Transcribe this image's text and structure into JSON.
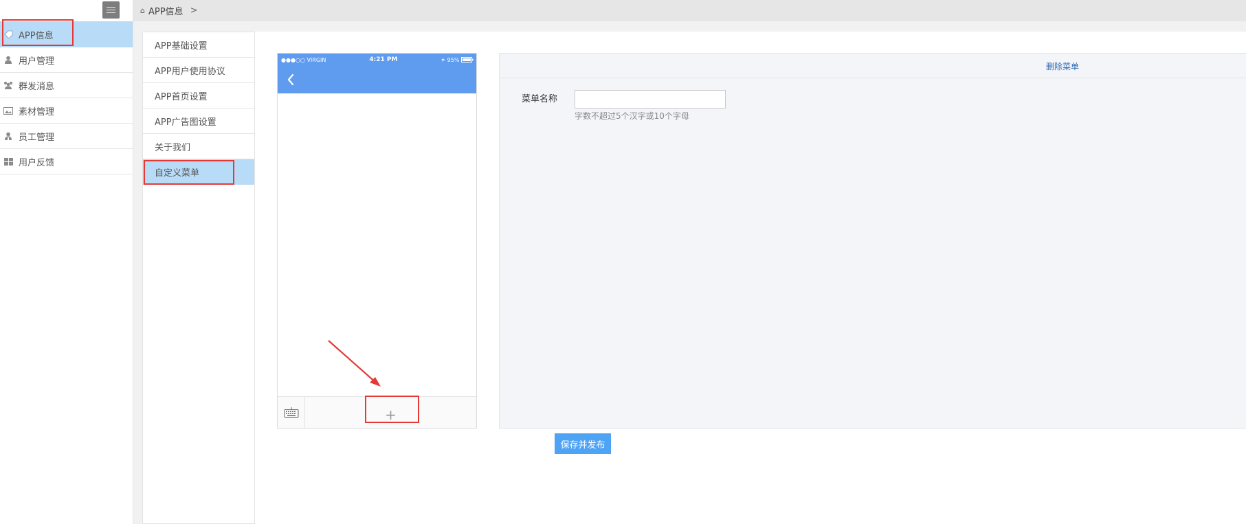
{
  "sidebar": {
    "items": [
      {
        "label": "APP信息",
        "icon": "tag-icon",
        "active": true
      },
      {
        "label": "用户管理",
        "icon": "user-icon",
        "active": false
      },
      {
        "label": "群发消息",
        "icon": "users-icon",
        "active": false
      },
      {
        "label": "素材管理",
        "icon": "image-icon",
        "active": false
      },
      {
        "label": "员工管理",
        "icon": "staff-icon",
        "active": false
      },
      {
        "label": "用户反馈",
        "icon": "grid-icon",
        "active": false
      }
    ]
  },
  "breadcrumb": {
    "current": "APP信息",
    "separator": ">"
  },
  "submenu": {
    "items": [
      {
        "label": "APP基础设置"
      },
      {
        "label": "APP用户使用协议"
      },
      {
        "label": "APP首页设置"
      },
      {
        "label": "APP广告图设置"
      },
      {
        "label": "关于我们"
      },
      {
        "label": "自定义菜单",
        "active": true
      }
    ]
  },
  "phone": {
    "carrier": "●●●○○ VIRGIN",
    "time": "4:21 PM",
    "battery": "95%",
    "add_label": "+"
  },
  "edit": {
    "delete_label": "删除菜单",
    "name_label": "菜单名称",
    "name_value": "",
    "name_hint": "字数不超过5个汉字或10个字母"
  },
  "actions": {
    "save_label": "保存并发布"
  },
  "colors": {
    "accent": "#5f9cef",
    "active_bg": "#b8dbf7",
    "button": "#4ea3f5",
    "annotation": "#e53935"
  }
}
